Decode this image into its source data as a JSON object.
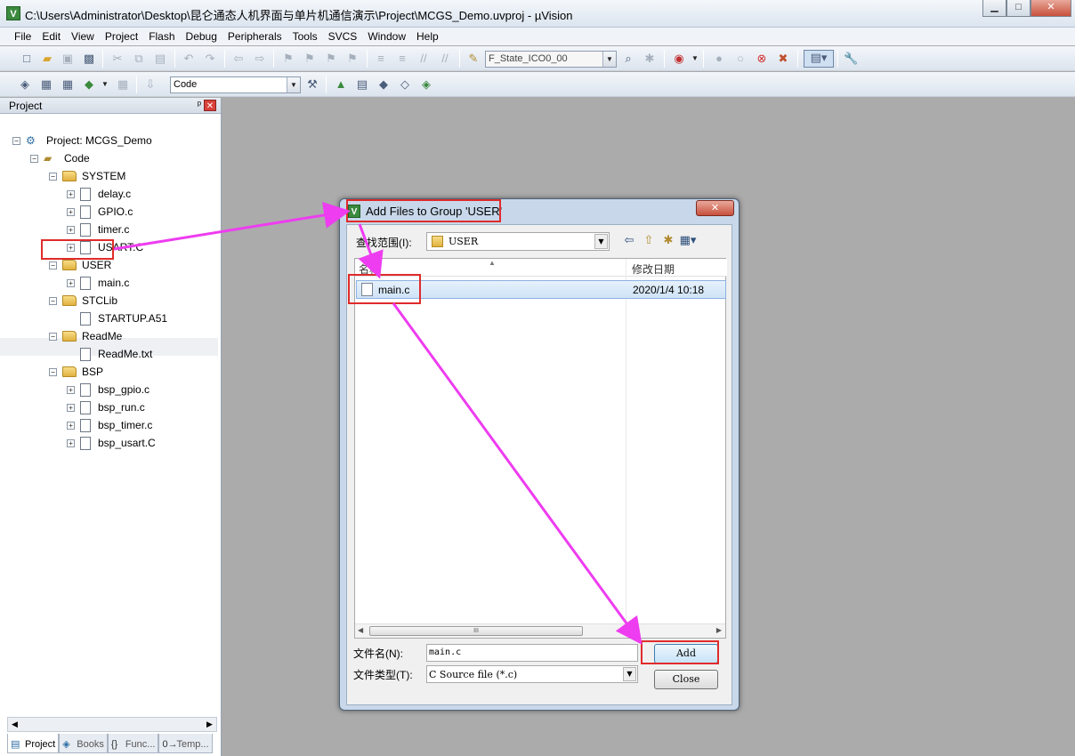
{
  "window": {
    "title": "C:\\Users\\Administrator\\Desktop\\昆仑通态人机界面与单片机通信演示\\Project\\MCGS_Demo.uvproj - µVision",
    "icon": "uvision-icon",
    "minimize": "▁",
    "maximize": "□",
    "close": "✕"
  },
  "menu": [
    "File",
    "Edit",
    "View",
    "Project",
    "Flash",
    "Debug",
    "Peripherals",
    "Tools",
    "SVCS",
    "Window",
    "Help"
  ],
  "toolbar": {
    "target_combo": "F_State_ICO0_00",
    "build_target": "Code"
  },
  "project_panel": {
    "title": "Project",
    "pin": "ᵖ",
    "close": "✕",
    "tree": {
      "project": "Project: MCGS_Demo",
      "target": "Code",
      "groups": [
        {
          "name": "SYSTEM",
          "files": [
            "delay.c",
            "GPIO.c",
            "timer.c",
            "USART.C"
          ]
        },
        {
          "name": "USER",
          "files": [
            "main.c"
          ]
        },
        {
          "name": "STCLib",
          "files": [
            "STARTUP.A51"
          ]
        },
        {
          "name": "ReadMe",
          "files": [
            "ReadMe.txt"
          ]
        },
        {
          "name": "BSP",
          "files": [
            "bsp_gpio.c",
            "bsp_run.c",
            "bsp_timer.c",
            "bsp_usart.C"
          ]
        }
      ]
    },
    "tabs": [
      "Project",
      "Books",
      "Func...",
      "Temp..."
    ]
  },
  "dialog": {
    "title": "Add Files to Group 'USER'",
    "look_in_label": "查找范围(I):",
    "look_in_value": "USER",
    "columns": [
      "名称",
      "修改日期"
    ],
    "files": [
      {
        "name": "main.c",
        "date": "2020/1/4 10:18"
      }
    ],
    "filename_label": "文件名(N):",
    "filename_value": "main.c",
    "filetype_label": "文件类型(T):",
    "filetype_value": "C Source file (*.c)",
    "add_button": "Add",
    "close_button": "Close",
    "close_x": "✕",
    "scroll_grip": "III"
  },
  "colors": {
    "annotation_red": "#e02b2b",
    "annotation_arrow": "#ee3cf0",
    "selection": "#cfe3f7"
  }
}
